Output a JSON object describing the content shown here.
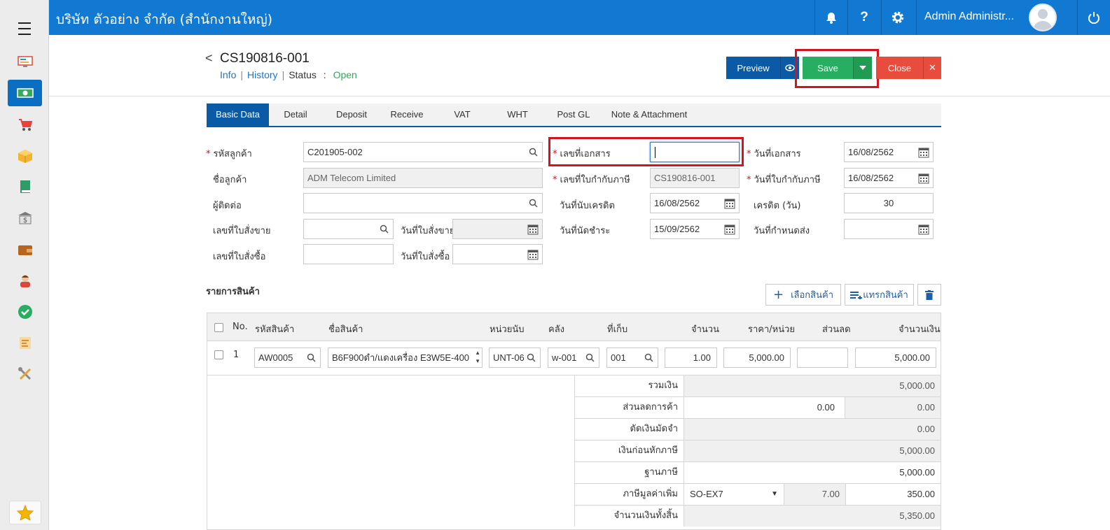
{
  "app": {
    "company": "บริษัท ตัวอย่าง จำกัด (สำนักงานใหญ่)",
    "user": "Admin Administr..."
  },
  "sidebar": {
    "icons": [
      "monitor-icon",
      "money-icon",
      "cart-icon",
      "box-icon",
      "book-icon",
      "bank-icon",
      "wallet-icon",
      "person-icon",
      "check-icon",
      "report-icon",
      "tools-icon"
    ],
    "favorite_icon": "star-icon"
  },
  "document": {
    "back": "<",
    "number": "CS190816-001",
    "info_link": "Info",
    "history_link": "History",
    "status_label": "Status",
    "status_sep": ":",
    "status_value": "Open",
    "sep": "|"
  },
  "buttons": {
    "preview": "Preview",
    "save": "Save",
    "close": "Close"
  },
  "tabs": [
    "Basic Data",
    "Detail",
    "Deposit",
    "Receive",
    "VAT",
    "WHT",
    "Post GL",
    "Note & Attachment"
  ],
  "form": {
    "customer_code_label": "รหัสลูกค้า",
    "customer_code": "C201905-002",
    "customer_name_label": "ชื่อลูกค้า",
    "customer_name": "ADM Telecom Limited",
    "contact_label": "ผู้ติดต่อ",
    "contact": "",
    "sales_order_no_label": "เลขที่ใบสั่งขาย",
    "sales_order_no": "",
    "sales_order_date_label": "วันที่ใบสั่งขาย",
    "sales_order_date": "",
    "purchase_order_no_label": "เลขที่ใบสั่งซื้อ",
    "purchase_order_no": "",
    "purchase_order_date_label": "วันที่ใบสั่งซื้อ",
    "purchase_order_date": "",
    "doc_no_label": "เลขที่เอกสาร",
    "doc_no": "",
    "tax_invoice_no_label": "เลขที่ใบกำกับภาษี",
    "tax_invoice_no": "CS190816-001",
    "credit_start_label": "วันที่นับเครดิต",
    "credit_start": "16/08/2562",
    "due_date_label": "วันที่นัดชำระ",
    "due_date": "15/09/2562",
    "doc_date_label": "วันที่เอกสาร",
    "doc_date": "16/08/2562",
    "tax_invoice_date_label": "วันที่ใบกำกับภาษี",
    "tax_invoice_date": "16/08/2562",
    "credit_days_label": "เครดิต (วัน)",
    "credit_days": "30",
    "delivery_date_label": "วันที่กำหนดส่ง",
    "delivery_date": ""
  },
  "items": {
    "title": "รายการสินค้า",
    "select_btn": "เลือกสินค้า",
    "insert_btn": "แทรกสินค้า",
    "columns": [
      "No.",
      "รหัสสินค้า",
      "ชื่อสินค้า",
      "หน่วยนับ",
      "คลัง",
      "ที่เก็บ",
      "จำนวน",
      "ราคา/หน่วย",
      "ส่วนลด",
      "จำนวนเงิน"
    ],
    "rows": [
      {
        "no": "1",
        "code": "AW0005",
        "name": "B6F900ดำ/แดงเครื่อง E3W5E-400",
        "unit": "UNT-06",
        "warehouse": "w-001",
        "location": "001",
        "qty": "1.00",
        "price": "5,000.00",
        "discount": "",
        "amount": "5,000.00"
      }
    ]
  },
  "summary": {
    "subtotal_label": "รวมเงิน",
    "subtotal": "5,000.00",
    "trade_discount_label": "ส่วนลดการค้า",
    "trade_discount_input": "0.00",
    "trade_discount": "0.00",
    "deposit_label": "ตัดเงินมัดจำ",
    "deposit": "0.00",
    "before_tax_label": "เงินก่อนหักภาษี",
    "before_tax": "5,000.00",
    "tax_base_label": "ฐานภาษี",
    "tax_base": "5,000.00",
    "vat_label": "ภาษีมูลค่าเพิ่ม",
    "vat_code": "SO-EX7",
    "vat_rate": "7.00",
    "vat_amount": "350.00",
    "grand_total_label": "จำนวนเงินทั้งสิ้น",
    "grand_total": "5,350.00"
  },
  "colors": {
    "primary": "#1279d3",
    "save": "#27ae60",
    "close": "#e74c3c",
    "highlight": "#d11420"
  }
}
